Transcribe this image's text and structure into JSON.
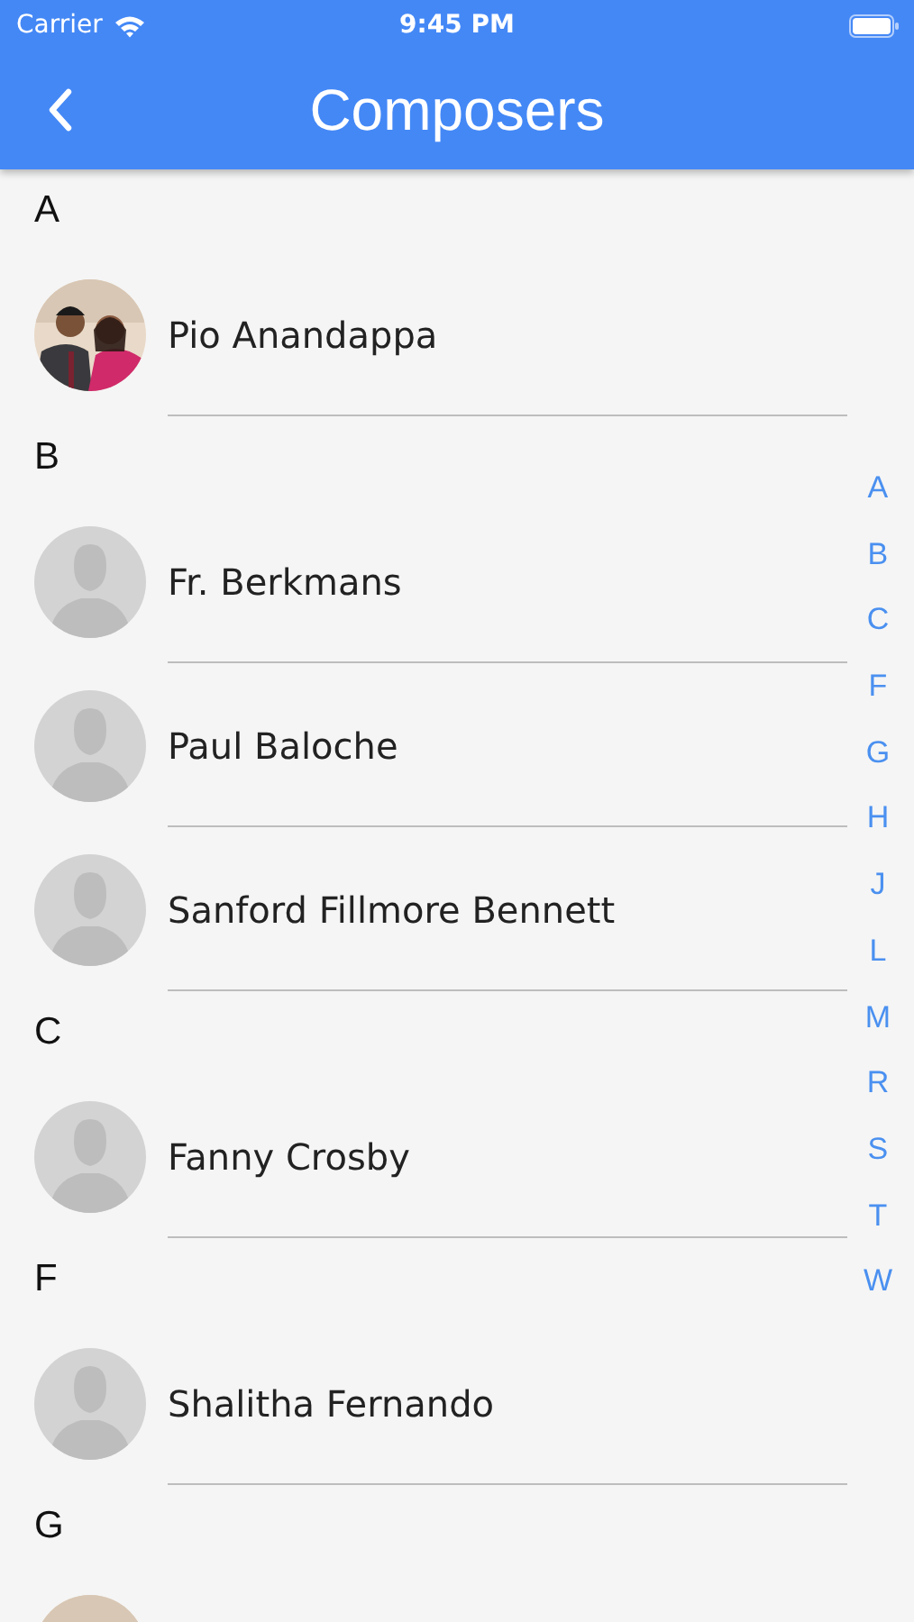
{
  "status_bar": {
    "carrier": "Carrier",
    "time": "9:45 PM"
  },
  "nav": {
    "title": "Composers"
  },
  "sections": [
    {
      "letter": "A",
      "rows": [
        {
          "name": "Pio Anandappa",
          "kind": "picture"
        }
      ]
    },
    {
      "letter": "B",
      "rows": [
        {
          "name": "Fr. Berkmans",
          "kind": "silhouette"
        },
        {
          "name": "Paul Baloche",
          "kind": "silhouette"
        },
        {
          "name": "Sanford Fillmore Bennett",
          "kind": "silhouette"
        }
      ]
    },
    {
      "letter": "C",
      "rows": [
        {
          "name": "Fanny Crosby",
          "kind": "silhouette"
        }
      ]
    },
    {
      "letter": "F",
      "rows": [
        {
          "name": "Shalitha Fernando",
          "kind": "silhouette"
        }
      ]
    },
    {
      "letter": "G"
    }
  ],
  "index": [
    "A",
    "B",
    "C",
    "F",
    "G",
    "H",
    "J",
    "L",
    "M",
    "R",
    "S",
    "T",
    "W"
  ]
}
